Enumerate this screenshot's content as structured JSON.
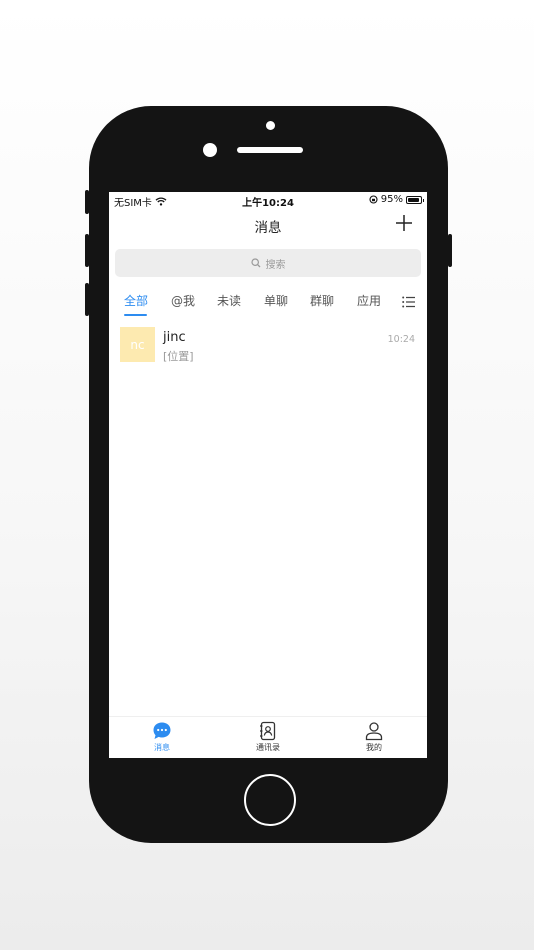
{
  "status_bar": {
    "carrier": "无SIM卡",
    "time": "上午10:24",
    "battery_percent": "95%",
    "battery_level": 0.95
  },
  "nav": {
    "title": "消息",
    "add_icon": "plus-icon"
  },
  "search": {
    "placeholder": "搜索",
    "icon": "search-icon"
  },
  "tabs": [
    {
      "label": "全部",
      "active": true
    },
    {
      "label": "@我",
      "active": false
    },
    {
      "label": "未读",
      "active": false
    },
    {
      "label": "单聊",
      "active": false
    },
    {
      "label": "群聊",
      "active": false
    },
    {
      "label": "应用",
      "active": false
    }
  ],
  "tab_menu_icon": "list-icon",
  "conversations": [
    {
      "avatar_text": "nc",
      "avatar_color": "#fdeab0",
      "name": "jinc",
      "preview": "[位置]",
      "time": "10:24"
    }
  ],
  "tabbar": [
    {
      "label": "消息",
      "icon": "chat-bubble-icon",
      "active": true
    },
    {
      "label": "通讯录",
      "icon": "contacts-book-icon",
      "active": false
    },
    {
      "label": "我的",
      "icon": "person-icon",
      "active": false
    }
  ],
  "colors": {
    "accent": "#2d8cf0",
    "phone_frame": "#141414"
  }
}
